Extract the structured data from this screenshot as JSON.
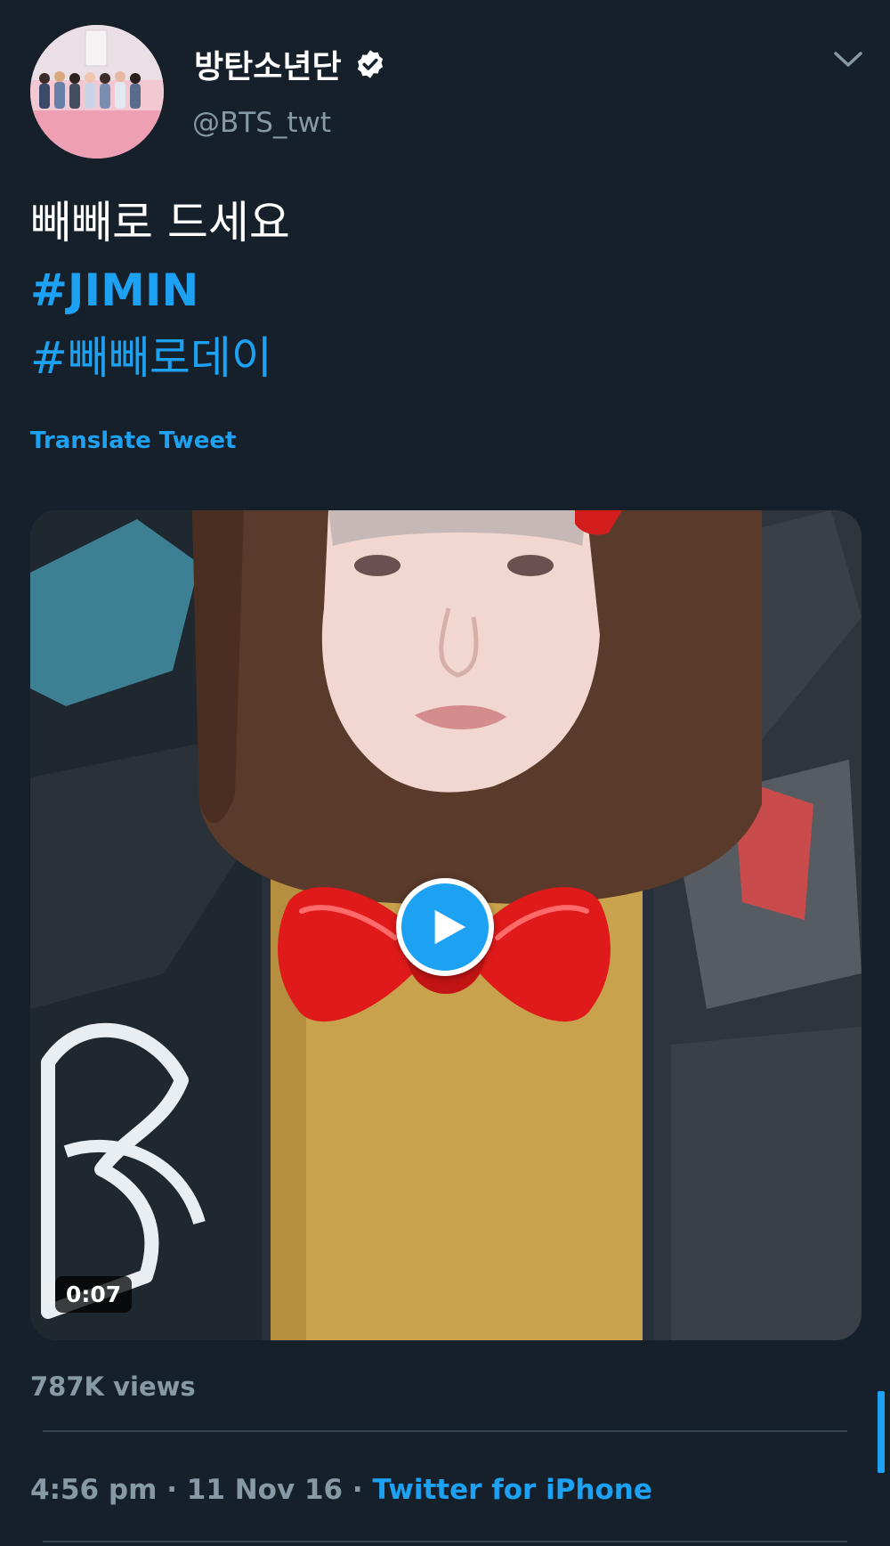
{
  "header": {
    "display_name": "방탄소년단",
    "handle": "@BTS_twt",
    "verified_icon": "verified-badge-icon",
    "menu_icon": "chevron-down-icon"
  },
  "tweet": {
    "text": "빼빼로 드세요",
    "hashtags": [
      "#JIMIN",
      "#빼빼로데이"
    ],
    "translate_label": "Translate Tweet"
  },
  "media": {
    "type": "video",
    "duration": "0:07",
    "play_icon": "play-icon"
  },
  "stats": {
    "views": "787K views"
  },
  "meta": {
    "time": "4:56 pm",
    "separator": "·",
    "date": "11 Nov 16",
    "source": "Twitter for iPhone"
  },
  "colors": {
    "background": "#15202b",
    "accent": "#1da1f2",
    "secondary_text": "#8899a6",
    "divider": "#38444d"
  }
}
